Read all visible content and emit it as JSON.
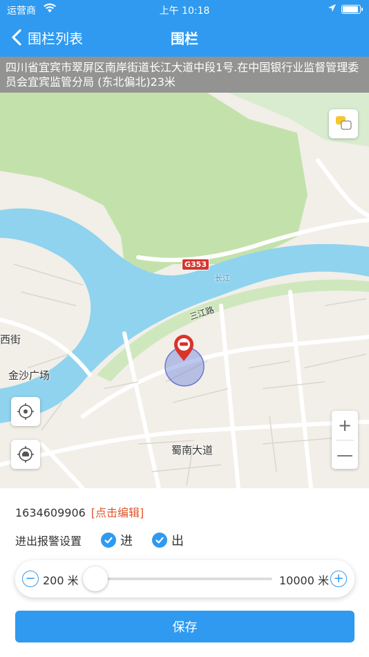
{
  "status_bar": {
    "carrier": "运营商",
    "time": "上午 10:18"
  },
  "nav": {
    "back_label": "围栏列表",
    "title": "围栏"
  },
  "map": {
    "address": "四川省宜宾市翠屏区南岸街道长江大道中段1号.在中国银行业监督管理委员会宜宾监管分局 (东北偏北)23米",
    "labels": {
      "road_badge": "G353",
      "river": "长江",
      "sanjiang_road": "三江路",
      "west_street": "西街",
      "jinsha_square": "金沙广场",
      "shunan_avenue": "蜀南大道"
    },
    "zoom_in": "+",
    "zoom_out": "—"
  },
  "fence": {
    "id": "1634609906",
    "edit_label": "[点击编辑]",
    "alarm_label": "进出报警设置",
    "enter_label": "进",
    "enter_checked": true,
    "exit_label": "出",
    "exit_checked": true
  },
  "radius_slider": {
    "min_label": "200 米",
    "max_label": "10000 米",
    "value_fraction": 0.0
  },
  "save_label": "保存",
  "colors": {
    "primary": "#2f9af0",
    "edit": "#e2542b",
    "river": "#8fd3ef",
    "park": "#b8dca0"
  }
}
